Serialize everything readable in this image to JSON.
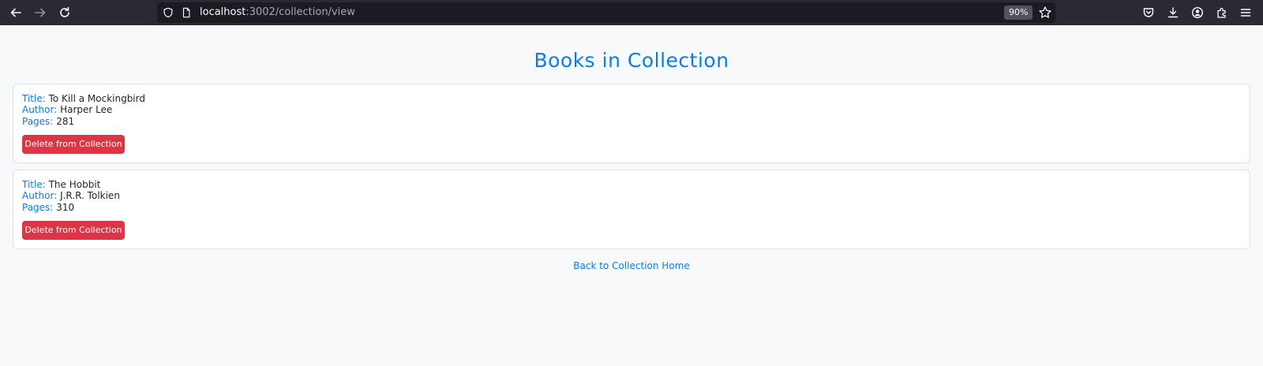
{
  "browser": {
    "url_host": "localhost",
    "url_path": ":3002/collection/view",
    "zoom": "90%"
  },
  "page": {
    "title": "Books in Collection",
    "back_link": "Back to Collection Home"
  },
  "labels": {
    "title": "Title:",
    "author": "Author:",
    "pages": "Pages:"
  },
  "books": [
    {
      "title": "To Kill a Mockingbird",
      "author": "Harper Lee",
      "pages": "281",
      "delete_label": "Delete from Collection"
    },
    {
      "title": "The Hobbit",
      "author": "J.R.R. Tolkien",
      "pages": "310",
      "delete_label": "Delete from Collection"
    }
  ],
  "colors": {
    "accent": "#0b7ce8",
    "danger": "#dc3545",
    "toolbar": "#2b2a33"
  },
  "icons": [
    "back-arrow-icon",
    "forward-arrow-icon",
    "reload-icon",
    "shield-icon",
    "page-icon",
    "star-icon",
    "pocket-icon",
    "download-icon",
    "account-icon",
    "extensions-icon",
    "menu-icon"
  ]
}
